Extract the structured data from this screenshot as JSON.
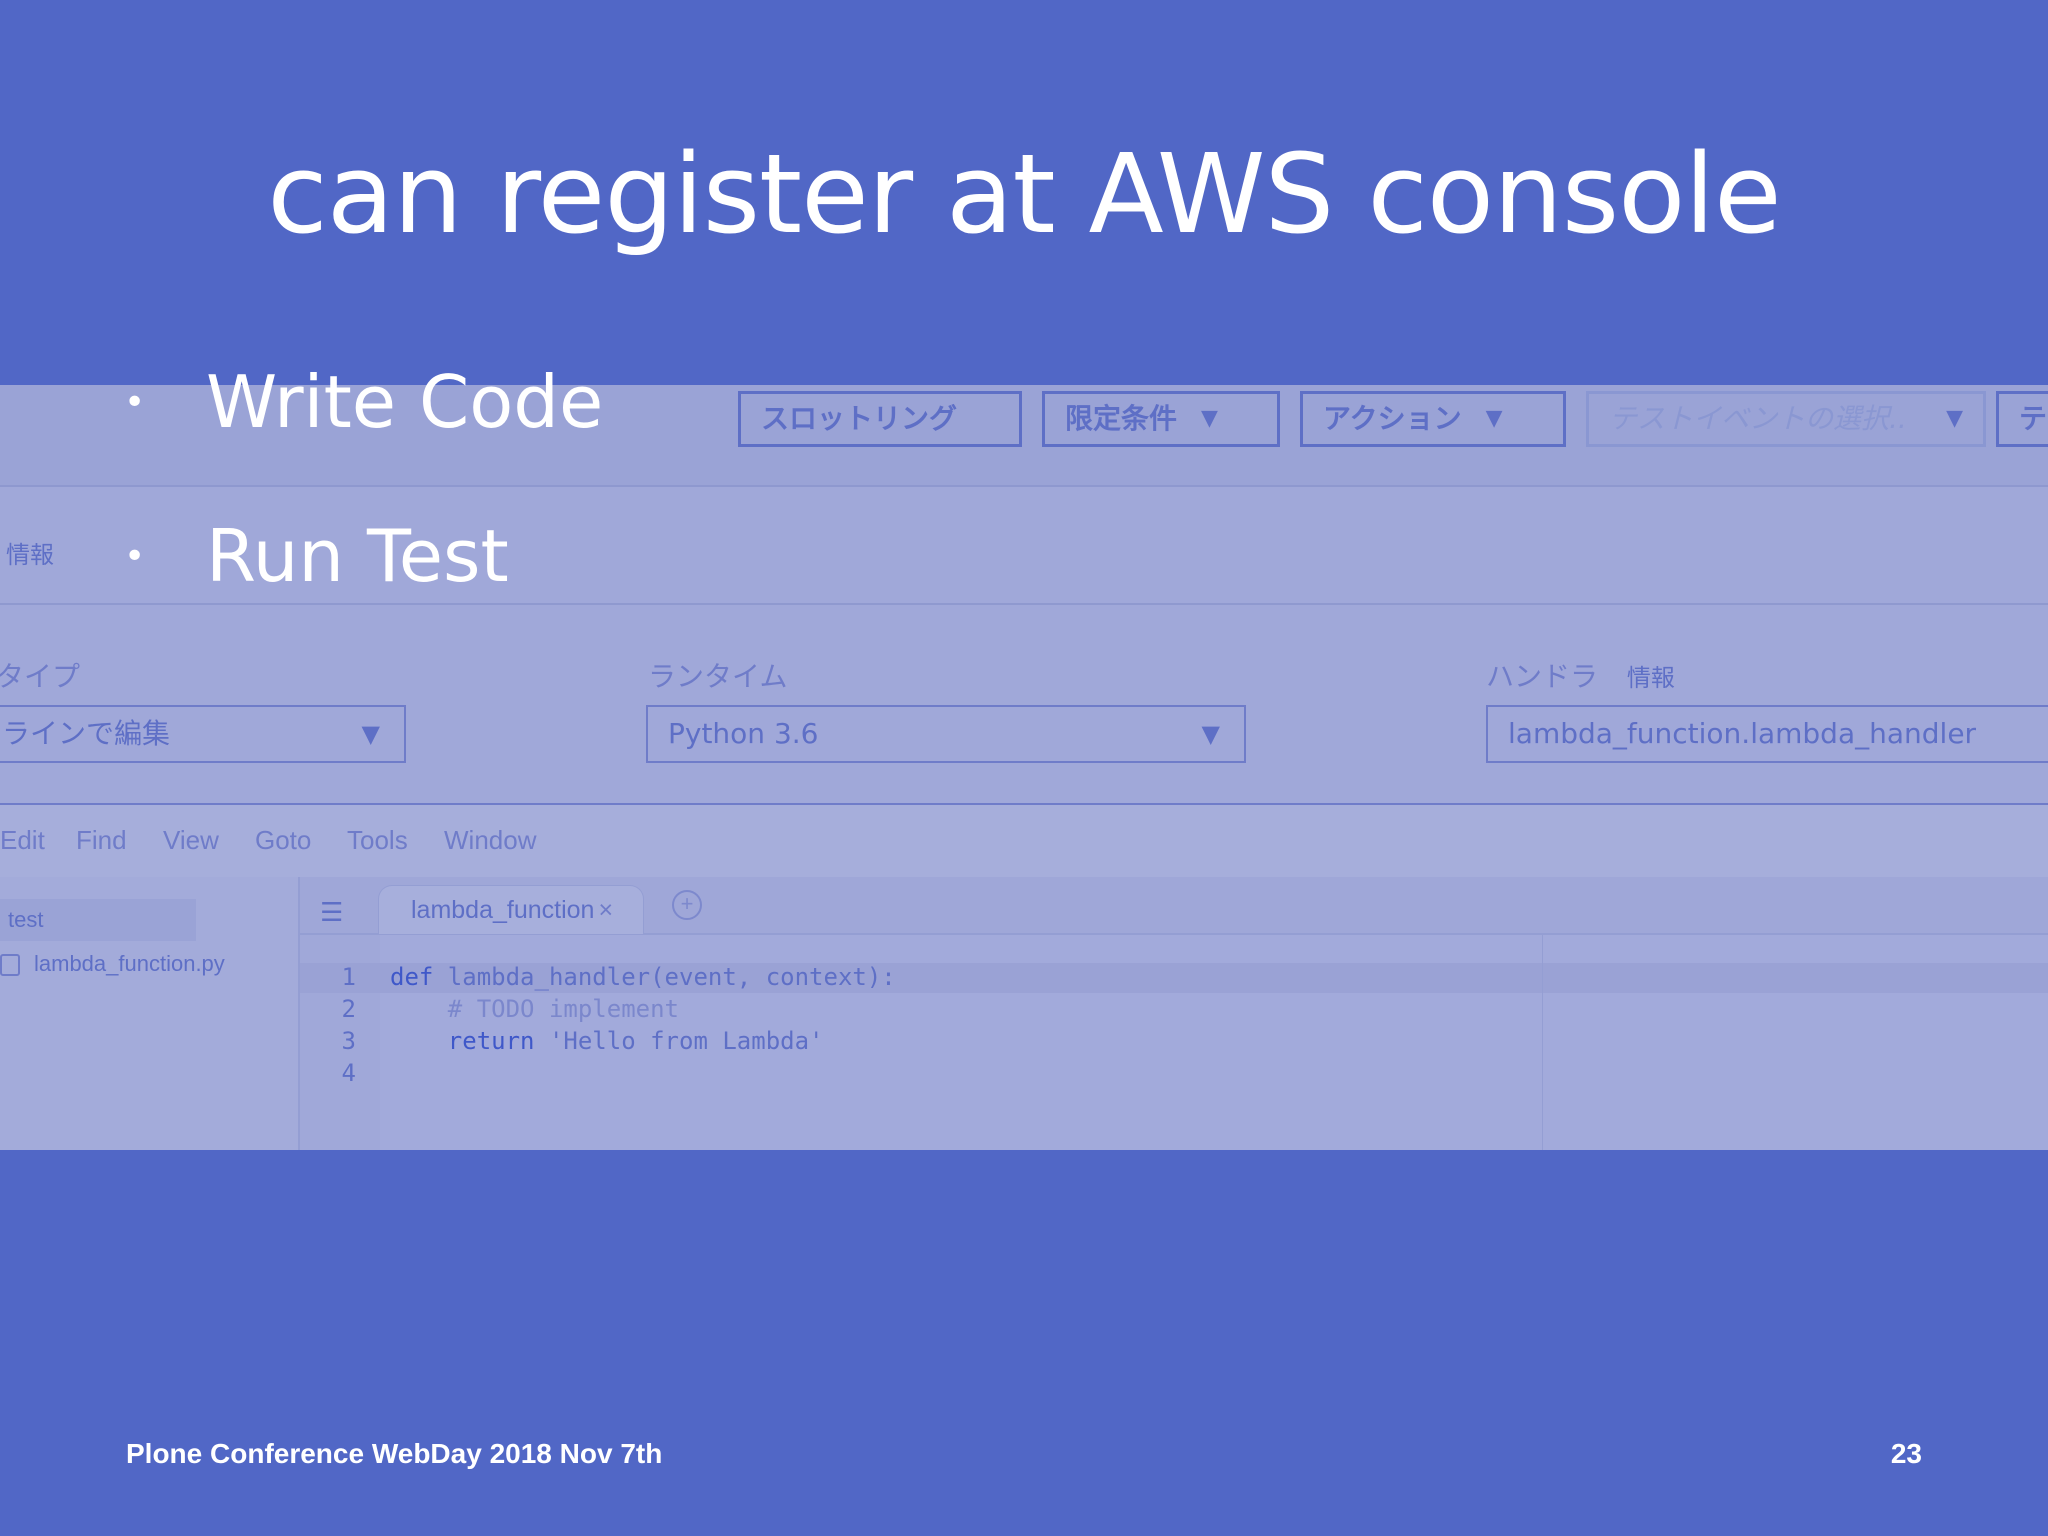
{
  "slide": {
    "title": "can register at AWS console",
    "bullets": [
      "Write Code",
      "Run Test"
    ],
    "footer": "Plone Conference WebDay 2018 Nov 7th",
    "page_number": "23"
  },
  "console": {
    "toolbar": {
      "throttling": "スロットリング",
      "qualifiers": "限定条件",
      "actions": "アクション",
      "test_event": "テストイベントの選択..",
      "overflow": "テ"
    },
    "info_link": "情報",
    "fields": {
      "code_entry_label": "タイプ",
      "code_entry_value": "ラインで編集",
      "runtime_label": "ランタイム",
      "runtime_value": "Python 3.6",
      "handler_label": "ハンドラ",
      "handler_info": "情報",
      "handler_value": "lambda_function.lambda_handler"
    },
    "menu": [
      "Edit",
      "Find",
      "View",
      "Goto",
      "Tools",
      "Window"
    ],
    "files": {
      "folder": "test",
      "file": "lambda_function.py"
    },
    "tab": {
      "label": "lambda_function",
      "close": "×"
    },
    "code": [
      {
        "num": "1",
        "kw": "def",
        "text": " lambda_handler(event, context):"
      },
      {
        "num": "2",
        "text": "    # TODO implement"
      },
      {
        "num": "3",
        "kw": "    return",
        "text": " 'Hello from Lambda'"
      },
      {
        "num": "4",
        "text": ""
      }
    ]
  }
}
